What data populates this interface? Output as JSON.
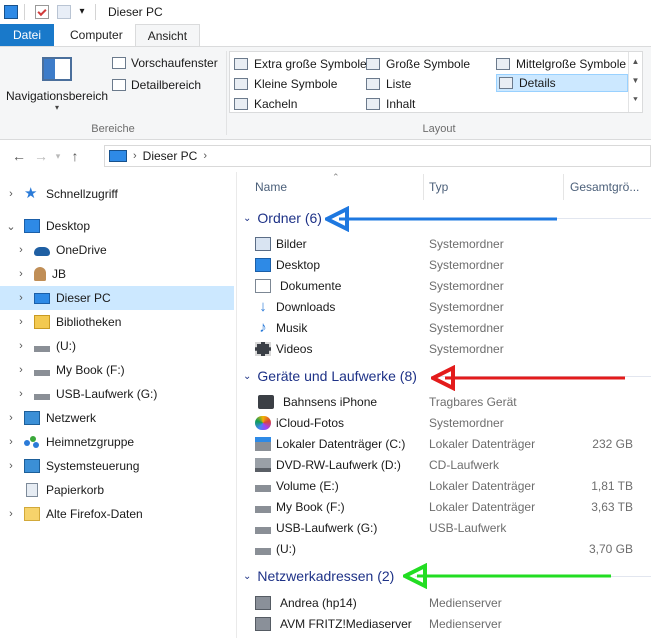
{
  "window": {
    "title": "Dieser PC"
  },
  "ribbon_tabs": [
    {
      "label": "Datei"
    },
    {
      "label": "Computer"
    },
    {
      "label": "Ansicht"
    }
  ],
  "ribbon": {
    "panes": {
      "navigation_label": "Navigationsbereich",
      "preview_label": "Vorschaufenster",
      "details_label": "Detailbereich",
      "group_label": "Bereiche"
    },
    "layout": {
      "group_label": "Layout",
      "items": [
        {
          "label": "Extra große Symbole",
          "selected": false
        },
        {
          "label": "Große Symbole",
          "selected": false
        },
        {
          "label": "Mittelgroße Symbole",
          "selected": false
        },
        {
          "label": "Kleine Symbole",
          "selected": false
        },
        {
          "label": "Liste",
          "selected": false
        },
        {
          "label": "Details",
          "selected": true
        },
        {
          "label": "Kacheln",
          "selected": false
        },
        {
          "label": "Inhalt",
          "selected": false
        }
      ]
    }
  },
  "address": {
    "crumb": "Dieser PC"
  },
  "nav_tree": [
    {
      "label": "Schnellzugriff",
      "icon": "star-icon",
      "selected": false
    },
    {
      "label": "Desktop",
      "icon": "desktop-icon",
      "selected": false,
      "expanded": true
    },
    {
      "label": "OneDrive",
      "icon": "cloud-icon",
      "selected": false
    },
    {
      "label": "JB",
      "icon": "user-icon",
      "selected": false
    },
    {
      "label": "Dieser PC",
      "icon": "pc-icon",
      "selected": true
    },
    {
      "label": "Bibliotheken",
      "icon": "library-icon",
      "selected": false
    },
    {
      "label": "(U:)",
      "icon": "drive-icon",
      "selected": false
    },
    {
      "label": "My Book (F:)",
      "icon": "drive-icon",
      "selected": false
    },
    {
      "label": "USB-Laufwerk (G:)",
      "icon": "usb-drive-icon",
      "selected": false
    },
    {
      "label": "Netzwerk",
      "icon": "network-icon",
      "selected": false
    },
    {
      "label": "Heimnetzgruppe",
      "icon": "homegroup-icon",
      "selected": false
    },
    {
      "label": "Systemsteuerung",
      "icon": "control-panel-icon",
      "selected": false
    },
    {
      "label": "Papierkorb",
      "icon": "recycle-bin-icon",
      "selected": false
    },
    {
      "label": "Alte Firefox-Daten",
      "icon": "folder-icon",
      "selected": false
    }
  ],
  "columns": {
    "name": "Name",
    "type": "Typ",
    "size": "Gesamtgrö..."
  },
  "groups": [
    {
      "title": "Ordner (6)",
      "arrow_color": "#1e78e0",
      "rows": [
        {
          "name": "Bilder",
          "type": "Systemordner",
          "size": "",
          "icon": "pictures-icon"
        },
        {
          "name": "Desktop",
          "type": "Systemordner",
          "size": "",
          "icon": "desktop-icon"
        },
        {
          "name": "Dokumente",
          "type": "Systemordner",
          "size": "",
          "icon": "documents-icon"
        },
        {
          "name": "Downloads",
          "type": "Systemordner",
          "size": "",
          "icon": "download-icon"
        },
        {
          "name": "Musik",
          "type": "Systemordner",
          "size": "",
          "icon": "music-icon"
        },
        {
          "name": "Videos",
          "type": "Systemordner",
          "size": "",
          "icon": "video-icon"
        }
      ]
    },
    {
      "title": "Geräte und Laufwerke (8)",
      "arrow_color": "#e31b1b",
      "rows": [
        {
          "name": "Bahnsens iPhone",
          "type": "Tragbares Gerät",
          "size": "",
          "icon": "phone-icon"
        },
        {
          "name": "iCloud-Fotos",
          "type": "Systemordner",
          "size": "",
          "icon": "photos-icon"
        },
        {
          "name": "Lokaler Datenträger (C:)",
          "type": "Lokaler Datenträger",
          "size": "232 GB",
          "icon": "system-drive-icon"
        },
        {
          "name": "DVD-RW-Laufwerk (D:)",
          "type": "CD-Laufwerk",
          "size": "",
          "icon": "dvd-drive-icon"
        },
        {
          "name": "Volume (E:)",
          "type": "Lokaler Datenträger",
          "size": "1,81 TB",
          "icon": "drive-icon"
        },
        {
          "name": "My Book (F:)",
          "type": "Lokaler Datenträger",
          "size": "3,63 TB",
          "icon": "drive-icon"
        },
        {
          "name": "USB-Laufwerk (G:)",
          "type": "USB-Laufwerk",
          "size": "",
          "icon": "usb-drive-icon"
        },
        {
          "name": "(U:)",
          "type": "",
          "size": "3,70 GB",
          "icon": "drive-icon"
        }
      ]
    },
    {
      "title": "Netzwerkadressen (2)",
      "arrow_color": "#22dd22",
      "rows": [
        {
          "name": "Andrea (hp14)",
          "type": "Medienserver",
          "size": "",
          "icon": "media-server-icon"
        },
        {
          "name": "AVM FRITZ!Mediaserver",
          "type": "Medienserver",
          "size": "",
          "icon": "media-server-icon"
        }
      ]
    }
  ],
  "colors": {
    "accent": "#1979ca",
    "selection": "#cce8ff",
    "group_header": "#1e3287"
  }
}
